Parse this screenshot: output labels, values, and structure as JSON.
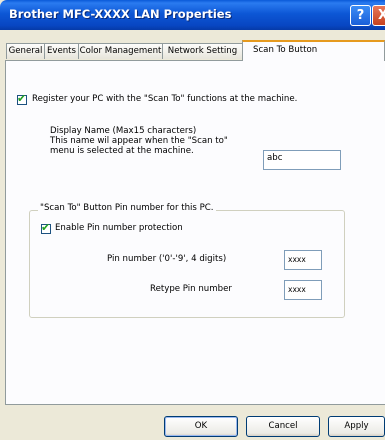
{
  "window": {
    "title": "Brother MFC-XXXX LAN Properties",
    "help_glyph": "?",
    "close_glyph": "X"
  },
  "tabs": [
    {
      "label": "General"
    },
    {
      "label": "Events"
    },
    {
      "label": "Color Management"
    },
    {
      "label": "Network Setting"
    },
    {
      "label": "Scan To Button"
    }
  ],
  "register": {
    "checked": true,
    "label": "Register your PC with the \"Scan To\" functions at the machine."
  },
  "display_name": {
    "lines": [
      "Display Name (Max15 characters)",
      "This name wil appear when the \"Scan to\"",
      "menu is selected at the machine."
    ],
    "value": "abc"
  },
  "pin_group": {
    "title": "\"Scan To\" Button Pin number for this PC.",
    "enable_checked": true,
    "enable_label": "Enable Pin number protection",
    "pin_label": "Pin number ('0'-'9', 4 digits)",
    "pin_value": "xxxx",
    "retype_label": "Retype Pin number",
    "retype_value": "xxxx"
  },
  "check_glyph": "✔",
  "buttons": {
    "ok": "OK",
    "cancel": "Cancel",
    "apply": "Apply"
  }
}
